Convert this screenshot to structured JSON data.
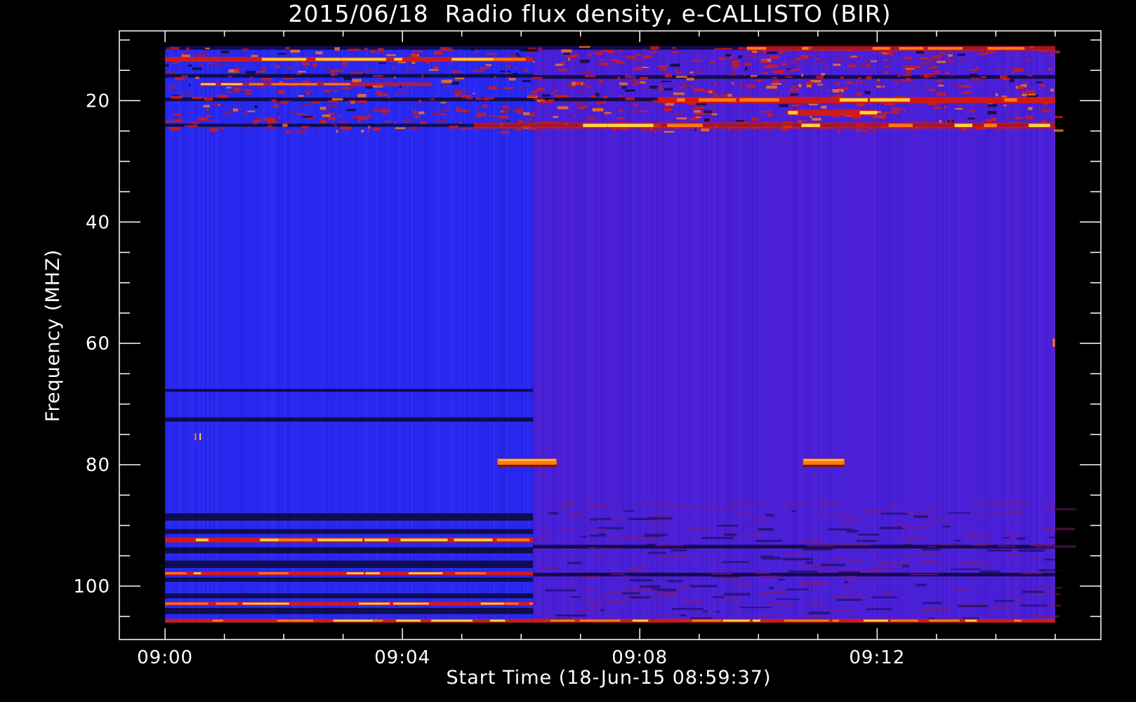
{
  "chart_data": {
    "type": "heatmap",
    "title": "2015/06/18  Radio flux density, e-CALLISTO (BIR)",
    "xlabel": "Start Time (18-Jun-15 08:59:37)",
    "ylabel": "Frequency (MHZ)",
    "x_axis": {
      "unit": "minutes after 09:00",
      "range": [
        -0.77,
        15.77
      ],
      "data_range": [
        0,
        15
      ],
      "ticks": [
        {
          "value": 0,
          "label": "09:00"
        },
        {
          "value": 4,
          "label": "09:04"
        },
        {
          "value": 8,
          "label": "09:08"
        },
        {
          "value": 12,
          "label": "09:12"
        }
      ],
      "minor_tick_step": 1
    },
    "y_axis": {
      "unit": "MHz",
      "inverted": true,
      "range": [
        8.5,
        108.8
      ],
      "data_range": [
        11,
        106
      ],
      "ticks": [
        {
          "value": 20,
          "label": "20"
        },
        {
          "value": 40,
          "label": "40"
        },
        {
          "value": 60,
          "label": "60"
        },
        {
          "value": 80,
          "label": "80"
        },
        {
          "value": 100,
          "label": "100"
        }
      ],
      "minor_tick_step": 5
    },
    "grid": false,
    "colors": {
      "background": "#000000",
      "axes": "#ffffff",
      "base_early": "#2828f0",
      "base_late": "#4a1fd8",
      "dark_band": "#0c0830",
      "red": "#d81a10",
      "orange": "#ff7a10",
      "yellow": "#ffd23c"
    },
    "regions": {
      "segment_break_minute": 6.2
    },
    "features": [
      {
        "kind": "interference",
        "t": [
          0,
          6.2
        ],
        "f": [
          12.8,
          13.6
        ],
        "intensity": "high"
      },
      {
        "kind": "interference",
        "t": [
          0.6,
          4.5
        ],
        "f": [
          17.0,
          17.6
        ],
        "intensity": "medium"
      },
      {
        "kind": "interference",
        "t": [
          8.3,
          15
        ],
        "f": [
          19.4,
          20.4
        ],
        "intensity": "high"
      },
      {
        "kind": "interference",
        "t": [
          9.8,
          15
        ],
        "f": [
          11.0,
          11.8
        ],
        "intensity": "medium"
      },
      {
        "kind": "interference",
        "t": [
          10.5,
          12.0
        ],
        "f": [
          21.5,
          22.5
        ],
        "intensity": "high"
      },
      {
        "kind": "interference",
        "t": [
          5.2,
          15
        ],
        "f": [
          23.6,
          24.6
        ],
        "intensity": "medium"
      },
      {
        "kind": "burst",
        "t": [
          5.6,
          6.6
        ],
        "f": [
          79.0,
          80.0
        ],
        "intensity": "high"
      },
      {
        "kind": "burst",
        "t": [
          10.75,
          11.45
        ],
        "f": [
          79.0,
          80.0
        ],
        "intensity": "high"
      },
      {
        "kind": "interference",
        "t": [
          0,
          6.2
        ],
        "f": [
          92.0,
          92.8
        ],
        "intensity": "high"
      },
      {
        "kind": "interference",
        "t": [
          0,
          6.2
        ],
        "f": [
          97.6,
          98.2
        ],
        "intensity": "high"
      },
      {
        "kind": "interference",
        "t": [
          0,
          6.2
        ],
        "f": [
          102.6,
          103.2
        ],
        "intensity": "high"
      },
      {
        "kind": "interference",
        "t": [
          0,
          15
        ],
        "f": [
          105.4,
          106.0
        ],
        "intensity": "high"
      }
    ]
  }
}
